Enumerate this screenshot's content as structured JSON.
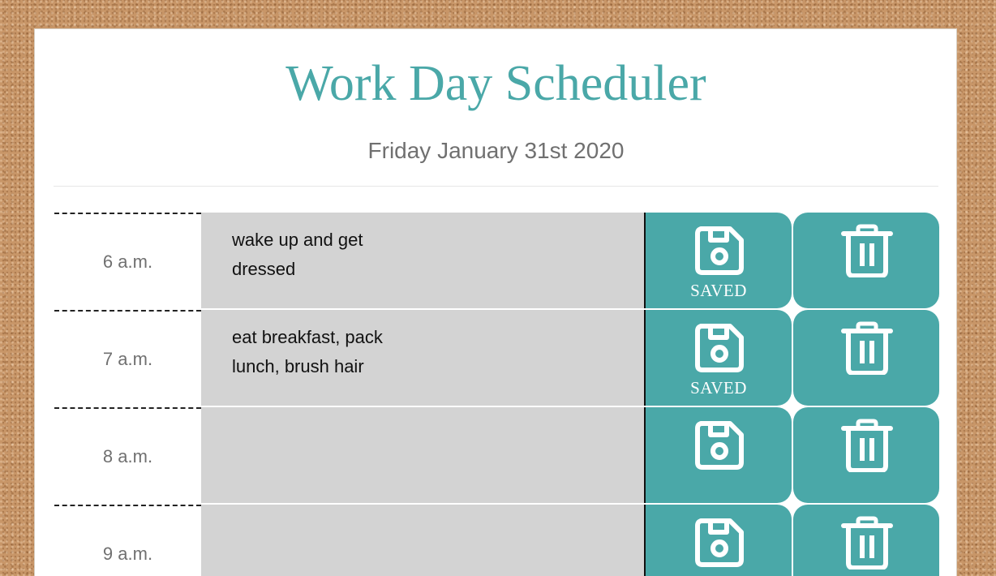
{
  "header": {
    "title": "Work Day Scheduler",
    "date": "Friday January 31st 2020"
  },
  "colors": {
    "accent": "#4aa8a8",
    "task_bg": "#d3d3d3",
    "corkboard": "#c89668"
  },
  "rows": [
    {
      "hour": "6 a.m.",
      "task": "wake up and get dressed",
      "saved_label": "SAVED",
      "save_icon": "floppy-disk-icon",
      "delete_icon": "trash-icon"
    },
    {
      "hour": "7 a.m.",
      "task": "eat breakfast, pack lunch, brush hair",
      "saved_label": "SAVED",
      "save_icon": "floppy-disk-icon",
      "delete_icon": "trash-icon"
    },
    {
      "hour": "8 a.m.",
      "task": "",
      "saved_label": "",
      "save_icon": "floppy-disk-icon",
      "delete_icon": "trash-icon"
    },
    {
      "hour": "9 a.m.",
      "task": "",
      "saved_label": "",
      "save_icon": "floppy-disk-icon",
      "delete_icon": "trash-icon"
    }
  ]
}
